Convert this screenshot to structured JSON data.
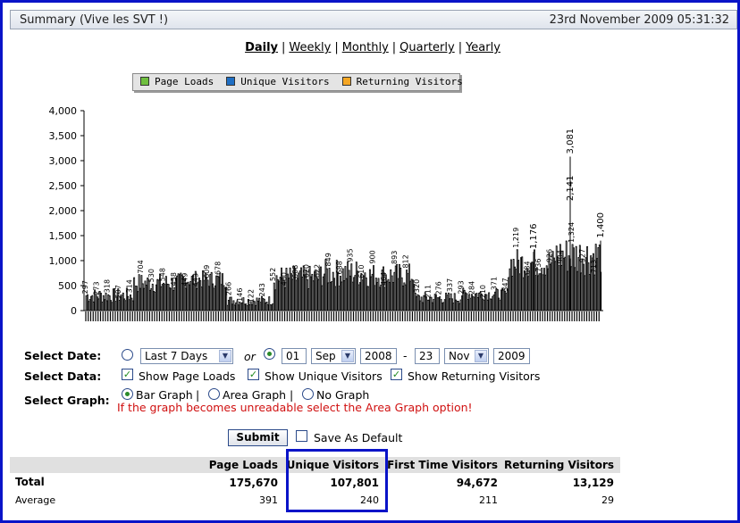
{
  "header": {
    "title": "Summary (Vive les SVT !)",
    "date": "23rd November 2009 05:31:32"
  },
  "period_nav": [
    "Daily",
    "Weekly",
    "Monthly",
    "Quarterly",
    "Yearly"
  ],
  "legend": [
    {
      "label": "Page Loads",
      "color": "#6fbf3f"
    },
    {
      "label": "Unique Visitors",
      "color": "#1f6fc4"
    },
    {
      "label": "Returning Visitors",
      "color": "#f5a623"
    }
  ],
  "chart_data": {
    "type": "bar",
    "ylim": [
      0,
      4000
    ],
    "yticks": [
      "0",
      "500",
      "1,000",
      "1,500",
      "2,000",
      "2,500",
      "3,000",
      "3,500",
      "4,000"
    ],
    "annotations": [
      {
        "label": "3,081",
        "value": 3081
      },
      {
        "label": "2,141",
        "value": 2141
      },
      {
        "label": "1,176",
        "value": 1176
      },
      {
        "label": "1,400",
        "value": 1400
      }
    ],
    "segments": [
      {
        "level": 300,
        "amp": 150
      },
      {
        "level": 550,
        "amp": 200
      },
      {
        "level": 620,
        "amp": 180
      },
      {
        "level": 200,
        "amp": 100
      },
      {
        "level": 650,
        "amp": 250
      },
      {
        "level": 750,
        "amp": 280
      },
      {
        "level": 700,
        "amp": 250
      },
      {
        "level": 250,
        "amp": 120
      },
      {
        "level": 330,
        "amp": 120
      },
      {
        "level": 950,
        "amp": 300
      },
      {
        "level": 1100,
        "amp": 400
      }
    ],
    "grid": false,
    "legend_position": "top"
  },
  "controls": {
    "select_date_label": "Select Date:",
    "preset_range": "Last 7 Days",
    "or_label": "or",
    "from_day": "01",
    "from_month": "Sep",
    "from_year": "2008",
    "dash": "-",
    "to_day": "23",
    "to_month": "Nov",
    "to_year": "2009",
    "select_data_label": "Select Data:",
    "show_page_loads": "Show Page Loads",
    "show_unique_visitors": "Show Unique Visitors",
    "show_returning_visitors": "Show Returning Visitors",
    "select_graph_label": "Select Graph:",
    "bar_graph": "Bar Graph",
    "area_graph": "Area Graph",
    "no_graph": "No Graph",
    "warning": "If the graph becomes unreadable select the Area Graph option!",
    "submit": "Submit",
    "save_default": "Save As Default"
  },
  "summary": {
    "columns": [
      "Page Loads",
      "Unique Visitors",
      "First Time Visitors",
      "Returning Visitors"
    ],
    "total": {
      "label": "Total",
      "values": [
        "175,670",
        "107,801",
        "94,672",
        "13,129"
      ]
    },
    "average": {
      "label": "Average",
      "values": [
        "391",
        "240",
        "211",
        "29"
      ]
    }
  }
}
